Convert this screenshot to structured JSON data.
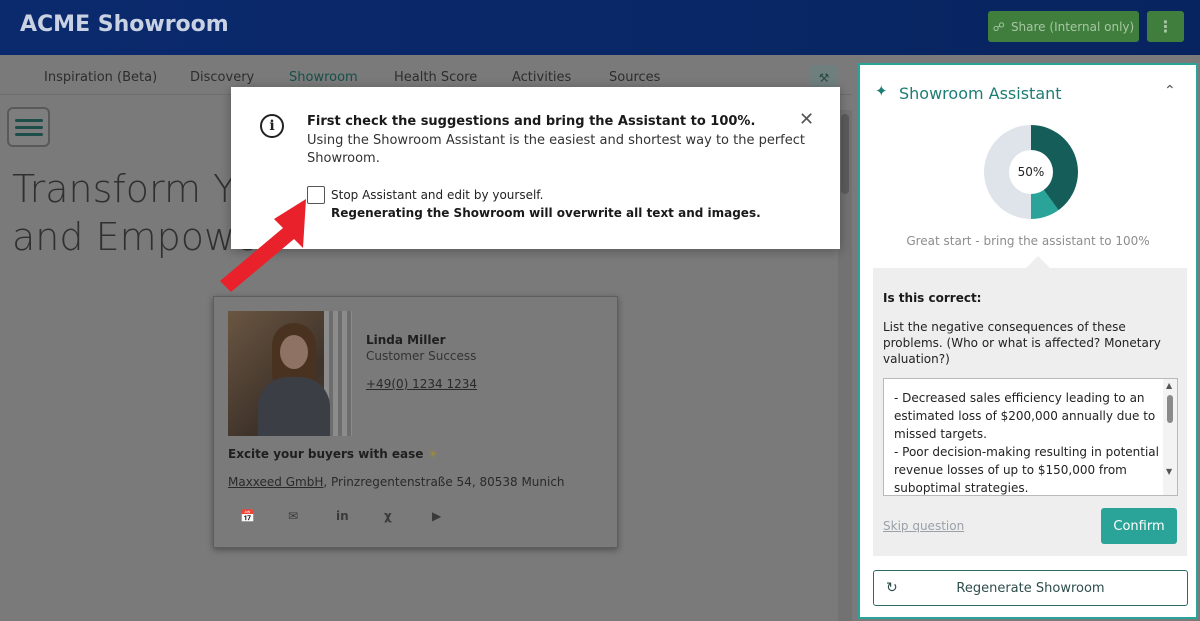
{
  "header": {
    "title": "ACME Showroom",
    "share_label": "Share (Internal only)",
    "more_label": "⋮"
  },
  "tabs": [
    {
      "label": "Inspiration (Beta)"
    },
    {
      "label": "Discovery"
    },
    {
      "label": "Showroom",
      "active": true
    },
    {
      "label": "Health Score"
    },
    {
      "label": "Activities"
    },
    {
      "label": "Sources"
    }
  ],
  "hero": {
    "line1": "Transform Yo",
    "line2": "and Empowe"
  },
  "contact": {
    "name": "Linda Miller",
    "role": "Customer Success",
    "phone": "+49(0) 1234 1234",
    "tagline": "Excite your buyers with ease",
    "company": "Maxxeed GmbH",
    "address": ", Prinzregentenstraße 54, 80538 Munich",
    "icons": [
      "calendar-icon",
      "mail-icon",
      "linkedin-icon",
      "xing-icon",
      "youtube-icon"
    ]
  },
  "modal": {
    "title": "First check the suggestions and bring the Assistant to 100%.",
    "description": "Using the Showroom Assistant is the easiest and shortest way to the perfect Showroom.",
    "checkbox_label": "Stop Assistant and edit by yourself.",
    "warning": "Regenerating the Showroom will overwrite all text and images.",
    "close_label": "✕"
  },
  "assistant": {
    "title": "Showroom Assistant",
    "progress_percent": 50,
    "progress_label": "50%",
    "progress_text": "Great start - bring the assistant to 100%",
    "question_label": "Is this correct:",
    "question_text": "List the negative consequences of these problems. (Who or what is affected? Monetary valuation?)",
    "answer_text": "- Decreased sales efficiency leading to an estimated loss of $200,000 annually due to missed targets.\n- Poor decision-making resulting in potential revenue losses of up to $150,000 from suboptimal strategies.",
    "skip_label": "Skip question",
    "confirm_label": "Confirm",
    "regenerate_label": "Regenerate Showroom"
  },
  "colors": {
    "accent": "#2aa398",
    "accent_dark": "#155d58",
    "header": "#0b2a6e",
    "share_button": "#3f7e3c",
    "arrow": "#e8212b"
  }
}
